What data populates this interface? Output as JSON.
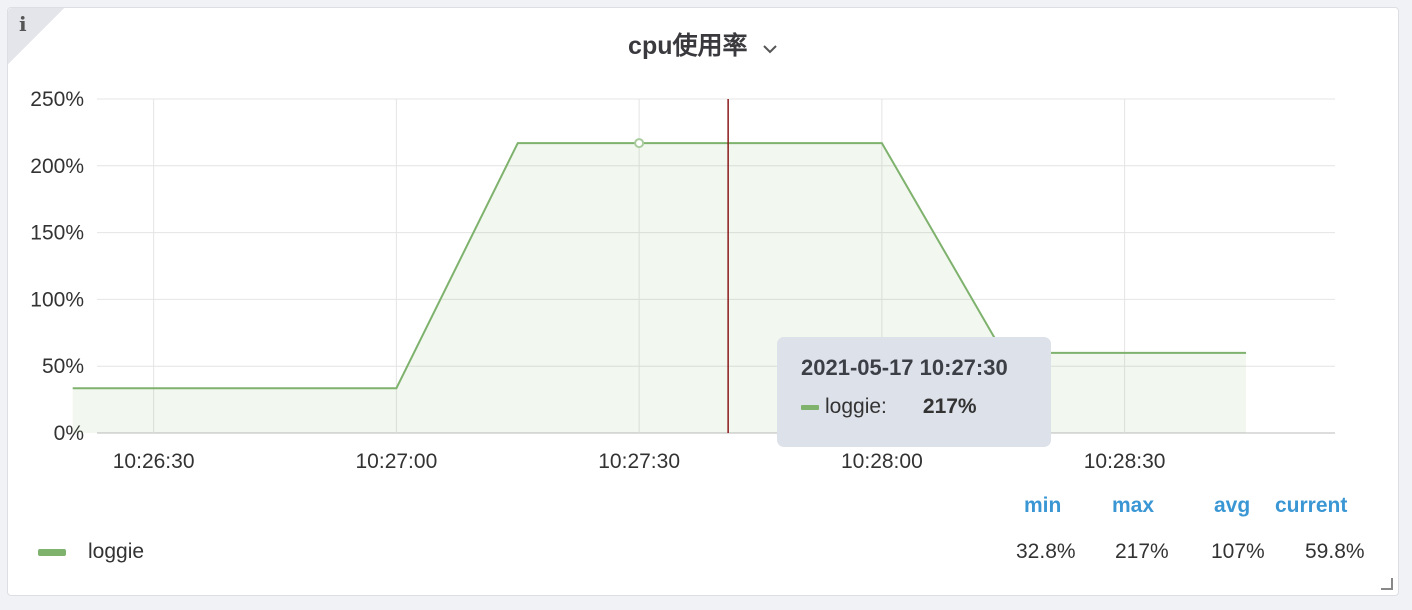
{
  "panel": {
    "title": "cpu使用率",
    "info_icon": "i"
  },
  "chart_data": {
    "type": "area",
    "x": [
      "10:26:20",
      "10:27:00",
      "10:27:15",
      "10:27:45",
      "10:28:00",
      "10:28:15",
      "10:28:45"
    ],
    "series": [
      {
        "name": "loggie",
        "values": [
          33.5,
          33.5,
          217,
          217,
          217,
          60,
          60
        ],
        "color": "#7eb26d"
      }
    ],
    "x_ticks": [
      "10:26:30",
      "10:27:00",
      "10:27:30",
      "10:28:00",
      "10:28:30"
    ],
    "y_ticks": [
      "0%",
      "50%",
      "100%",
      "150%",
      "200%",
      "250%"
    ],
    "ylim": [
      0,
      250
    ],
    "xlim": [
      "10:26:23",
      "10:28:56"
    ],
    "grid": true,
    "crosshair_time": "10:27:41",
    "hover_point_time": "10:27:30",
    "hover_value": 217
  },
  "tooltip": {
    "time": "2021-05-17 10:27:30",
    "series_name": "loggie:",
    "value": "217%"
  },
  "legend": {
    "headers": {
      "min": "min",
      "max": "max",
      "avg": "avg",
      "current": "current"
    },
    "series": [
      {
        "name": "loggie",
        "min": "32.8%",
        "max": "217%",
        "avg": "107%",
        "current": "59.8%",
        "color": "#7eb26d"
      }
    ]
  }
}
